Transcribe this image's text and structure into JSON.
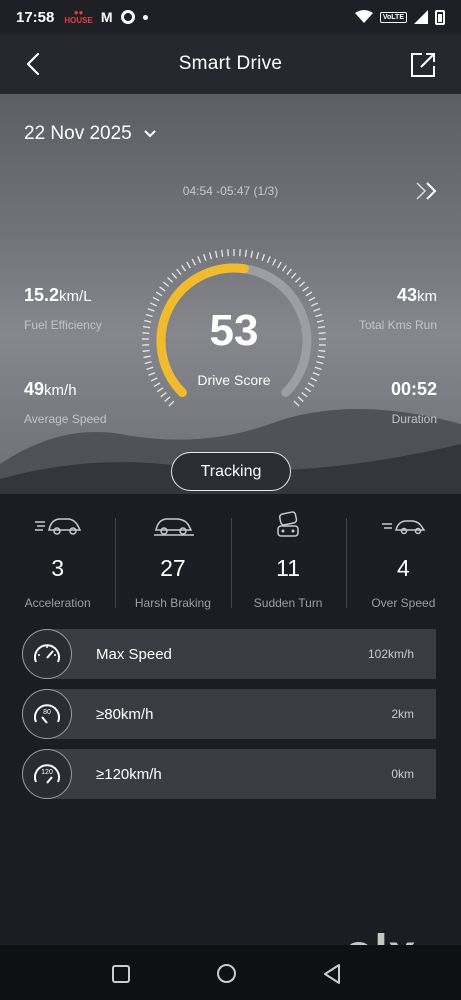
{
  "status_bar": {
    "time": "17:58",
    "mini_logo": "HOUSE",
    "mail_icon_label": "M",
    "volte": "VoLTE"
  },
  "header": {
    "title": "Smart Drive"
  },
  "date_selector": {
    "value": "22 Nov 2025"
  },
  "trip": {
    "time_range": "04:54 -05:47 (1/3)"
  },
  "stats": {
    "fuel_efficiency": {
      "value": "15.2",
      "unit": "km/L",
      "label": "Fuel Efficiency"
    },
    "total_kms": {
      "value": "43",
      "unit": "km",
      "label": "Total Kms Run"
    },
    "average_speed": {
      "value": "49",
      "unit": "km/h",
      "label": "Average Speed"
    },
    "duration": {
      "value": "00:52",
      "label": "Duration"
    }
  },
  "score": {
    "value": "53",
    "label": "Drive Score",
    "fraction": 0.53
  },
  "tracking_button": {
    "label": "Tracking"
  },
  "events": [
    {
      "icon": "acceleration-car-icon",
      "count": "3",
      "label": "Acceleration"
    },
    {
      "icon": "braking-car-icon",
      "count": "27",
      "label": "Harsh Braking"
    },
    {
      "icon": "sudden-turn-icon",
      "count": "11",
      "label": "Sudden Turn"
    },
    {
      "icon": "over-speed-car-icon",
      "count": "4",
      "label": "Over Speed"
    }
  ],
  "speed_rows": [
    {
      "icon": "speedometer-icon",
      "label": "Max Speed",
      "value": "102km/h"
    },
    {
      "icon": "speedometer-80-icon",
      "badge": "80",
      "label": "≥80km/h",
      "value": "2km"
    },
    {
      "icon": "speedometer-120-icon",
      "badge": "120",
      "label": "≥120km/h",
      "value": "0km"
    }
  ],
  "watermark": {
    "text": "olx"
  },
  "colors": {
    "gauge_active": "#f0bb2e",
    "gauge_track": "#9d9ea2",
    "accent_text": "#ffffff"
  }
}
